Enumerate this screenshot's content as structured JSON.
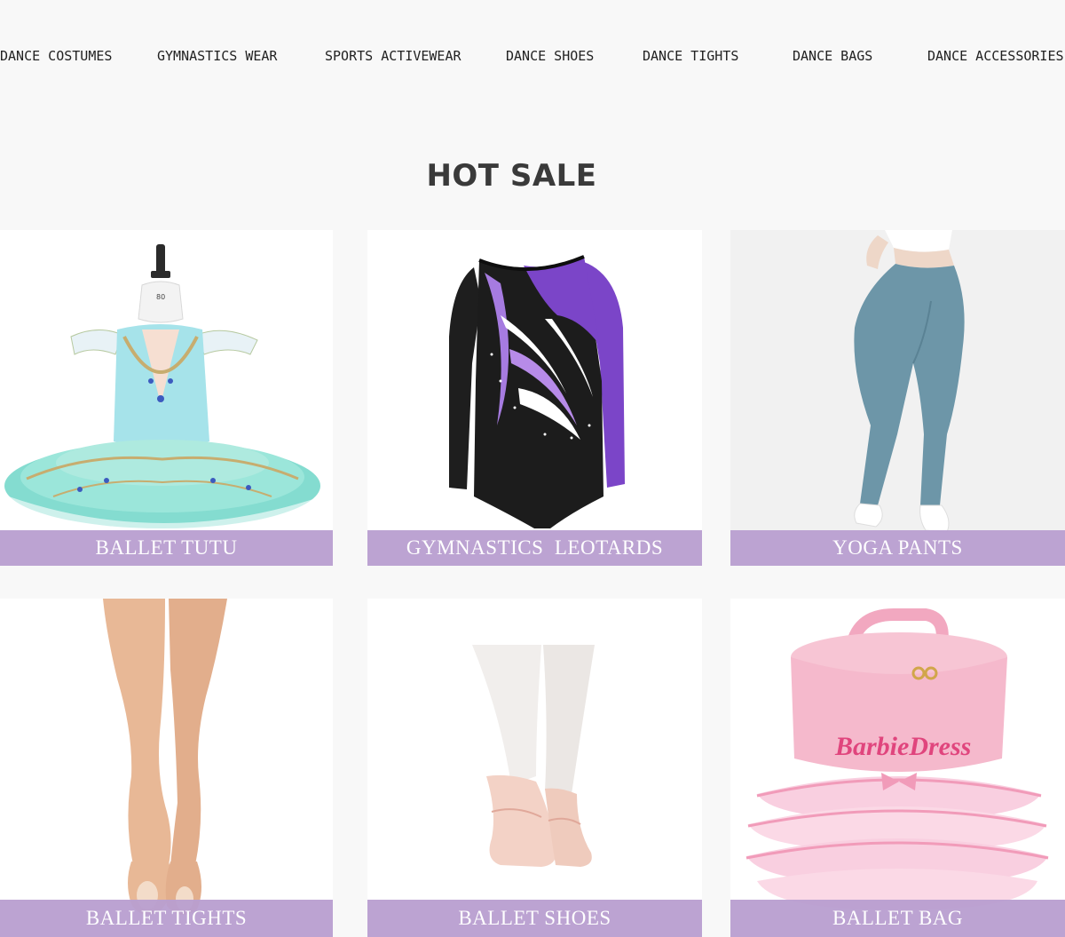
{
  "nav": {
    "items": [
      {
        "label": "DANCE COSTUMES"
      },
      {
        "label": "GYMNASTICS WEAR"
      },
      {
        "label": "SPORTS ACTIVEWEAR"
      },
      {
        "label": "DANCE SHOES"
      },
      {
        "label": "DANCE TIGHTS"
      },
      {
        "label": "DANCE BAGS"
      },
      {
        "label": "DANCE ACCESSORIES"
      }
    ]
  },
  "hot_sale": {
    "title": "HOT SALE",
    "products": [
      {
        "label": "BALLET TUTU",
        "image": "ballet-tutu-image"
      },
      {
        "label": "GYMNASTICS  LEOTARDS",
        "image": "gymnastics-leotard-image"
      },
      {
        "label": "YOGA PANTS",
        "image": "yoga-pants-image"
      },
      {
        "label": "BALLET TIGHTS",
        "image": "ballet-tights-image"
      },
      {
        "label": "BALLET SHOES",
        "image": "ballet-shoes-image"
      },
      {
        "label": "BALLET BAG",
        "image": "ballet-bag-image",
        "embroidery": "BarbieDress"
      }
    ]
  },
  "colors": {
    "label_bar": "#b89ed0",
    "page_bg": "#f8f8f8",
    "title": "#3a3a3a"
  }
}
